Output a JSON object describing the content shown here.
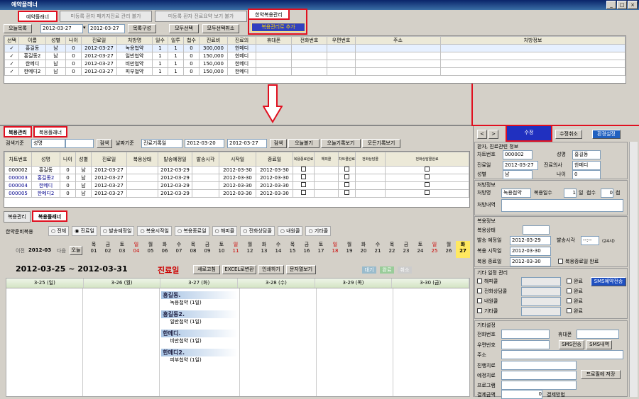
{
  "window": {
    "title": "예약플래너",
    "controls": [
      "_",
      "□",
      "×"
    ]
  },
  "top_tabs": [
    {
      "label": "예약플래너",
      "active": true
    },
    {
      "label": "미등록 환자 패키지진료 관리 불가",
      "active": false
    },
    {
      "label": "미등록 환자 진료요약 보기 불가",
      "active": false
    },
    {
      "label": "한약복용관리",
      "active": true
    }
  ],
  "add_btn": "복용관리로 추가",
  "toolbar1": {
    "today": "오늘목록",
    "date_from": "2012-03-27",
    "date_to": "2012-03-27",
    "compose": "목록구성",
    "select_all": "모두선택",
    "deselect_all": "모두선택취소"
  },
  "grid1": {
    "columns": [
      "선택",
      "이름",
      "성별",
      "나이",
      "진료일",
      "처방명",
      "일수",
      "일투",
      "첩수",
      "진료비",
      "진료의",
      "휴대폰",
      "전화번호",
      "우편번호",
      "주소",
      "처방정보"
    ],
    "rows": [
      [
        "✓",
        "홍길동",
        "남",
        "0",
        "2012-03-27",
        "녹용첩약",
        "1",
        "1",
        "0",
        "300,000",
        "한메디",
        "",
        "",
        "",
        "",
        ""
      ],
      [
        "✓",
        "홍길동2",
        "남",
        "0",
        "2012-03-27",
        "일반첩약",
        "1",
        "1",
        "0",
        "150,000",
        "한메디",
        "",
        "",
        "",
        "",
        ""
      ],
      [
        "✓",
        "한메디",
        "남",
        "0",
        "2012-03-27",
        "비만첩약",
        "1",
        "1",
        "0",
        "150,000",
        "한메디",
        "",
        "",
        "",
        "",
        ""
      ],
      [
        "✓",
        "한메디2",
        "남",
        "0",
        "2012-03-27",
        "피부첩약",
        "1",
        "1",
        "0",
        "150,000",
        "한메디",
        "",
        "",
        "",
        "",
        ""
      ]
    ]
  },
  "lower_tabs": [
    "복용관리",
    "복용플래너"
  ],
  "search": {
    "label": "검색기준",
    "field": "성명",
    "btn": "검색",
    "date_basis_label": "날짜기준",
    "basis": "진료기록일",
    "from": "2012-03-20",
    "to": "2012-03-27",
    "search2": "검색",
    "today": "오늘볼기",
    "today_rec": "오늘기록보기",
    "all_rec": "모든기록보기"
  },
  "grid2": {
    "columns": [
      "차트번호",
      "성명",
      "나이",
      "성별",
      "진료일",
      "복용상태",
      "발송예정일",
      "발송시각",
      "시작일",
      "종료일",
      "복용종료완료",
      "해피콜",
      "차트콜완료",
      "전화상담콜",
      "전화상담콜완료"
    ],
    "rows": [
      [
        "000002",
        "홍길동",
        "0",
        "남",
        "2012-03-27",
        "",
        "2012-03-29",
        "",
        "2012-03-30",
        "2012-03-30"
      ],
      [
        "000003",
        "홍길동2",
        "0",
        "남",
        "2012-03-27",
        "",
        "2012-03-29",
        "",
        "2012-03-30",
        "2012-03-30"
      ],
      [
        "000004",
        "한메디",
        "0",
        "남",
        "2012-03-27",
        "",
        "2012-03-29",
        "",
        "2012-03-30",
        "2012-03-30"
      ],
      [
        "000005",
        "한메디2",
        "0",
        "남",
        "2012-03-27",
        "",
        "2012-03-29",
        "",
        "2012-03-30",
        "2012-03-30"
      ]
    ]
  },
  "planner_tabs": [
    "복용관리",
    "복용플래너"
  ],
  "filter": {
    "label": "한약준비복용",
    "options": [
      "전체",
      "진료일",
      "발송예정일",
      "복용시작일",
      "복용종료일",
      "해피콜",
      "전화상담콜",
      "내원콜",
      "기타콜"
    ]
  },
  "month_nav": {
    "prev": "이전",
    "month": "2012-03",
    "next": "다음",
    "today": "오늘"
  },
  "days": [
    {
      "dow": "목",
      "d": "01"
    },
    {
      "dow": "금",
      "d": "02"
    },
    {
      "dow": "토",
      "d": "03"
    },
    {
      "dow": "일",
      "d": "04",
      "red": true
    },
    {
      "dow": "월",
      "d": "05"
    },
    {
      "dow": "화",
      "d": "06"
    },
    {
      "dow": "수",
      "d": "07"
    },
    {
      "dow": "목",
      "d": "08"
    },
    {
      "dow": "금",
      "d": "09"
    },
    {
      "dow": "토",
      "d": "10"
    },
    {
      "dow": "일",
      "d": "11",
      "red": true
    },
    {
      "dow": "월",
      "d": "12"
    },
    {
      "dow": "화",
      "d": "13"
    },
    {
      "dow": "수",
      "d": "14"
    },
    {
      "dow": "목",
      "d": "15"
    },
    {
      "dow": "금",
      "d": "16"
    },
    {
      "dow": "토",
      "d": "17"
    },
    {
      "dow": "일",
      "d": "18",
      "red": true
    },
    {
      "dow": "월",
      "d": "19"
    },
    {
      "dow": "화",
      "d": "20"
    },
    {
      "dow": "수",
      "d": "21"
    },
    {
      "dow": "목",
      "d": "22"
    },
    {
      "dow": "금",
      "d": "23"
    },
    {
      "dow": "토",
      "d": "24"
    },
    {
      "dow": "일",
      "d": "25",
      "red": true
    },
    {
      "dow": "월",
      "d": "26"
    },
    {
      "dow": "화",
      "d": "27",
      "today": true
    }
  ],
  "week": {
    "range": "2012-03-25 ~ 2012-03-31",
    "mode": "진료일",
    "refresh": "새로고침",
    "excel": "EXCEL로변환",
    "print": "인쇄하기",
    "sms": "문자열보기",
    "status": [
      "대기",
      "완료",
      "취소"
    ],
    "cols": [
      "3-25 (일)",
      "3-26 (월)",
      "3-27 (화)",
      "3-28 (수)",
      "3-29 (목)",
      "3-30 (금)"
    ],
    "entries": [
      {
        "name": "홍길동.",
        "rx": "녹용첩약 (1일)"
      },
      {
        "name": "홍길동2.",
        "rx": "일반첩약 (1일)"
      },
      {
        "name": "한메디.",
        "rx": "비만첩약 (1일)"
      },
      {
        "name": "한메디2.",
        "rx": "피부첩약 (1일)"
      }
    ]
  },
  "right": {
    "nav": [
      "<",
      ">"
    ],
    "edit": "수정",
    "cancel": "수정취소",
    "config": "환경설정",
    "patient": {
      "header": "환자, 진료관련 정보",
      "chart_lbl": "차트번호",
      "chart": "000002",
      "name_lbl": "성명",
      "name": "홍길동",
      "date_lbl": "진료일",
      "date": "2012-03-27",
      "doctor_lbl": "진료의사",
      "doctor": "한메디",
      "sex_lbl": "성별",
      "sex": "남",
      "age_lbl": "나이",
      "age": "0"
    },
    "rx": {
      "header": "처방정보",
      "name_lbl": "처방명",
      "name": "녹용첩약",
      "days_lbl": "복용일수",
      "days": "1",
      "unit1": "일",
      "cheop_lbl": "첩수",
      "cheop": "0",
      "unit2": "첩",
      "detail_lbl": "처방내역"
    },
    "dose": {
      "header": "복용정보",
      "state_lbl": "복용상태",
      "send_lbl": "발송 예정일",
      "send": "2012-03-29",
      "time_lbl": "발송시각",
      "time": "--:--",
      "ampm": "(24시)",
      "start_lbl": "복용 시작일",
      "start": "2012-03-30",
      "end_lbl": "복용 종료일",
      "end": "2012-03-30",
      "done": "복용종료일 완료"
    },
    "calls": {
      "header": "기타 일정 관리",
      "items": [
        "해피콜",
        "전화상담콜",
        "내원콜",
        "기타콜"
      ],
      "done": "완료",
      "sms": "SMS예약전송"
    },
    "etc": {
      "header": "기타설정",
      "phone": "전화번호",
      "mobile": "휴대폰",
      "zip": "우편번호",
      "sms_send": "SMS전송",
      "sms_hist": "SMS내역",
      "addr": "주소",
      "diag": "진행치료",
      "plan": "예정치료",
      "program": "프로그램",
      "save": "프로필에 저장",
      "fee": "결제금액",
      "method": "결제방법",
      "fee_val": "0"
    }
  }
}
